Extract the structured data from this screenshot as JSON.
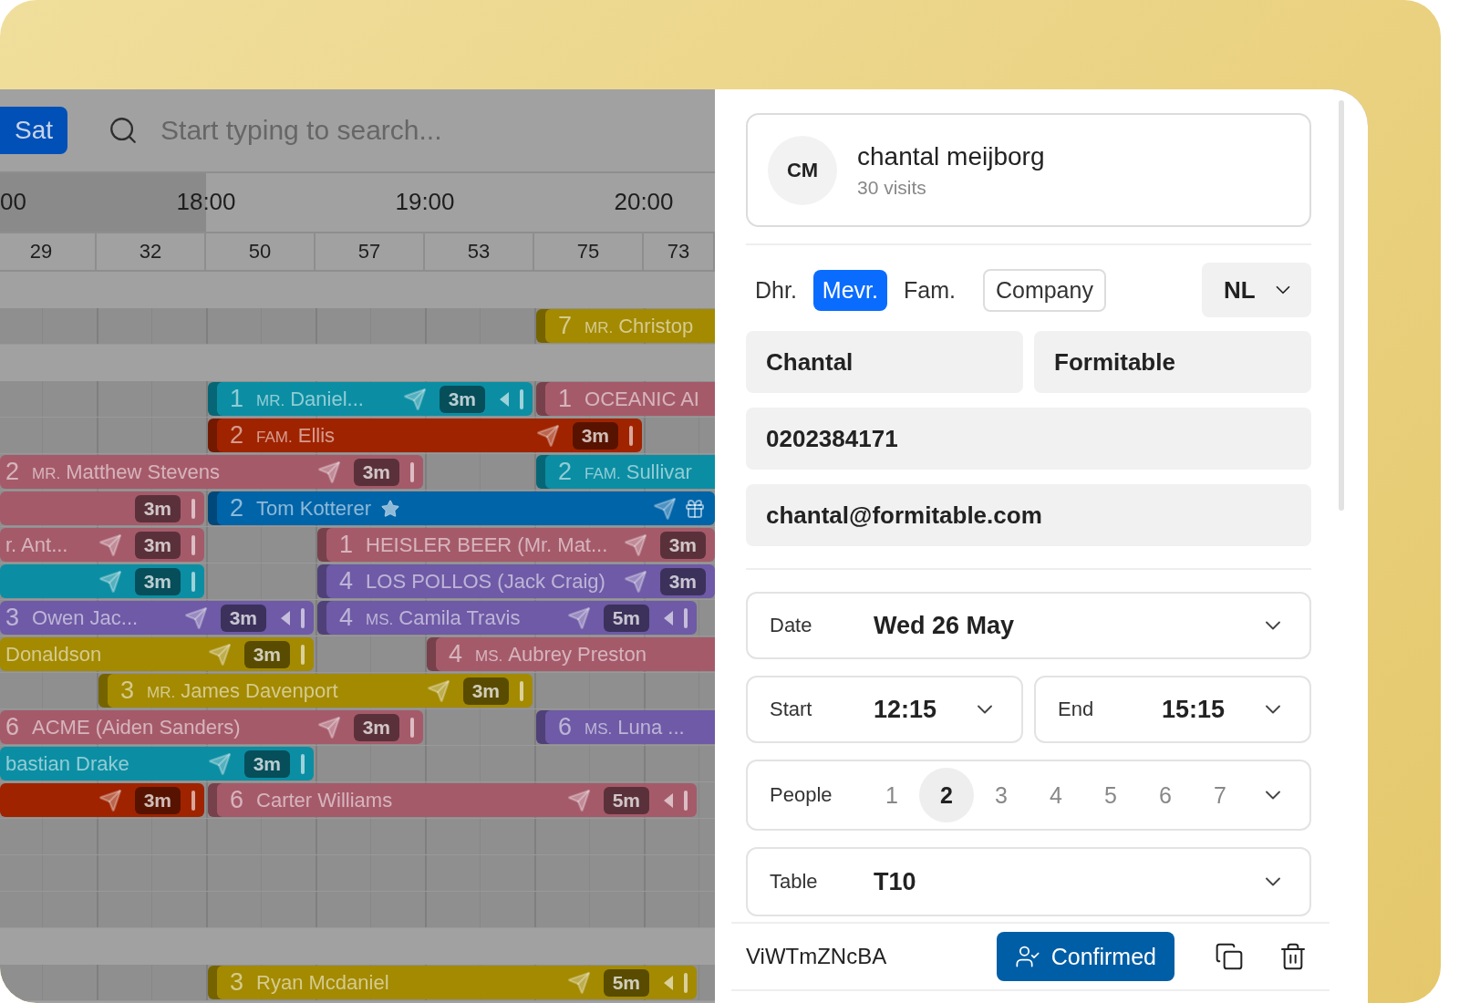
{
  "toolbar": {
    "day_button": "Sat",
    "search": {
      "placeholder": "Start typing to search..."
    }
  },
  "timeline": {
    "hours": [
      "00",
      "18:00",
      "19:00",
      "20:00"
    ],
    "counts": [
      "29",
      "32",
      "50",
      "57",
      "53",
      "75",
      "73"
    ],
    "rows": [
      {
        "kind": "section"
      },
      {
        "kind": "table",
        "bars": [
          {
            "color": "#a38a00",
            "count": "7",
            "prefix": "MR.",
            "name": "Christop"
          }
        ]
      },
      {
        "kind": "section"
      },
      {
        "kind": "table",
        "bars": [
          {
            "color": "#0b8ea3",
            "count": "1",
            "prefix": "MR.",
            "name": "Daniel...",
            "sent": true,
            "badge": "3m",
            "arrow": true,
            "handle": true
          },
          {
            "color": "#a55a6a",
            "count": "1",
            "name": "OCEANIC AI"
          }
        ]
      },
      {
        "kind": "table",
        "bars": [
          {
            "color": "#a02300",
            "count": "2",
            "prefix": "FAM.",
            "name": "Ellis",
            "sent": true,
            "badge": "3m",
            "handle": true
          }
        ]
      },
      {
        "kind": "table",
        "bars": [
          {
            "color": "#a55a6a",
            "count": "2",
            "prefix": "MR.",
            "name": "Matthew Stevens",
            "sent": true,
            "badge": "3m",
            "handle": true
          },
          {
            "color": "#0b8ea3",
            "count": "2",
            "prefix": "FAM.",
            "name": "Sullivar"
          }
        ]
      },
      {
        "kind": "table",
        "bars": [
          {
            "color": "#a55a6a",
            "badge": "3m",
            "handle": true
          },
          {
            "color": "#0064a8",
            "count": "2",
            "name": "Tom Kotterer",
            "star": true,
            "sent": true,
            "gift": true
          }
        ]
      },
      {
        "kind": "table",
        "bars": [
          {
            "color": "#a55a6a",
            "name": "r. Ant...",
            "sent": true,
            "badge": "3m",
            "handle": true
          },
          {
            "color": "#a55a6a",
            "count": "1",
            "name": "HEISLER BEER (Mr. Mat...",
            "sent": true,
            "badge": "3m"
          }
        ]
      },
      {
        "kind": "table",
        "bars": [
          {
            "color": "#0b8ea3",
            "sent": true,
            "badge": "3m",
            "handle": true
          },
          {
            "color": "#6e5aa6",
            "count": "4",
            "name": "LOS POLLOS (Jack Craig)",
            "sent": true,
            "badge": "3m"
          }
        ]
      },
      {
        "kind": "table",
        "bars": [
          {
            "color": "#6e5aa6",
            "count": "3",
            "name": "Owen Jac...",
            "sent": true,
            "badge": "3m",
            "arrow": true,
            "handle": true
          },
          {
            "color": "#6e5aa6",
            "count": "4",
            "prefix": "MS.",
            "name": "Camila Travis",
            "sent": true,
            "badge": "5m",
            "arrow": true,
            "handle": true
          }
        ]
      },
      {
        "kind": "table",
        "bars": [
          {
            "color": "#a38a00",
            "name": "Donaldson",
            "sent": true,
            "badge": "3m",
            "handle": true
          },
          {
            "color": "#a55a6a",
            "count": "4",
            "prefix": "MS.",
            "name": "Aubrey Preston"
          }
        ]
      },
      {
        "kind": "table",
        "bars": [
          {
            "color": "#a38a00",
            "count": "3",
            "prefix": "MR.",
            "name": "James Davenport",
            "sent": true,
            "badge": "3m",
            "handle": true
          }
        ]
      },
      {
        "kind": "table",
        "bars": [
          {
            "color": "#a55a6a",
            "count": "6",
            "name": "ACME (Aiden Sanders)",
            "sent": true,
            "badge": "3m",
            "handle": true
          },
          {
            "color": "#6e5aa6",
            "count": "6",
            "prefix": "MS.",
            "name": "Luna ..."
          }
        ]
      },
      {
        "kind": "table",
        "bars": [
          {
            "color": "#0b8ea3",
            "name": "bastian Drake",
            "sent": true,
            "badge": "3m",
            "handle": true
          }
        ]
      },
      {
        "kind": "table",
        "bars": [
          {
            "color": "#a02300",
            "sent": true,
            "badge": "3m",
            "handle": true
          },
          {
            "color": "#a55a6a",
            "count": "6",
            "name": "Carter Williams",
            "sent": true,
            "badge": "5m",
            "arrow": true,
            "handle": true
          }
        ]
      },
      {
        "kind": "table"
      },
      {
        "kind": "table"
      },
      {
        "kind": "table"
      },
      {
        "kind": "section"
      },
      {
        "kind": "table",
        "bars": [
          {
            "color": "#a38a00",
            "count": "3",
            "name": "Ryan Mcdaniel",
            "sent": true,
            "badge": "5m",
            "arrow": true,
            "handle": true
          }
        ]
      }
    ]
  },
  "panel": {
    "customer": {
      "initials": "CM",
      "name": "chantal meijborg",
      "visits": "30 visits"
    },
    "salutations": [
      {
        "label": "Dhr.",
        "selected": false
      },
      {
        "label": "Mevr.",
        "selected": true
      },
      {
        "label": "Fam.",
        "selected": false
      }
    ],
    "company_button": "Company",
    "language": "NL",
    "fields": {
      "first_name": "Chantal",
      "last_name": "Formitable",
      "phone": "0202384171",
      "email": "chantal@formitable.com"
    },
    "date": {
      "label": "Date",
      "value": "Wed 26 May"
    },
    "start": {
      "label": "Start",
      "value": "12:15"
    },
    "end": {
      "label": "End",
      "value": "15:15"
    },
    "people": {
      "label": "People",
      "options": [
        {
          "label": "1",
          "selected": false
        },
        {
          "label": "2",
          "selected": true
        },
        {
          "label": "3",
          "selected": false
        },
        {
          "label": "4",
          "selected": false
        },
        {
          "label": "5",
          "selected": false
        },
        {
          "label": "6",
          "selected": false
        },
        {
          "label": "7",
          "selected": false
        }
      ]
    },
    "table": {
      "label": "Table",
      "value": "T10"
    },
    "footer": {
      "code": "ViWTmZNcBA",
      "status": "Confirmed"
    }
  }
}
